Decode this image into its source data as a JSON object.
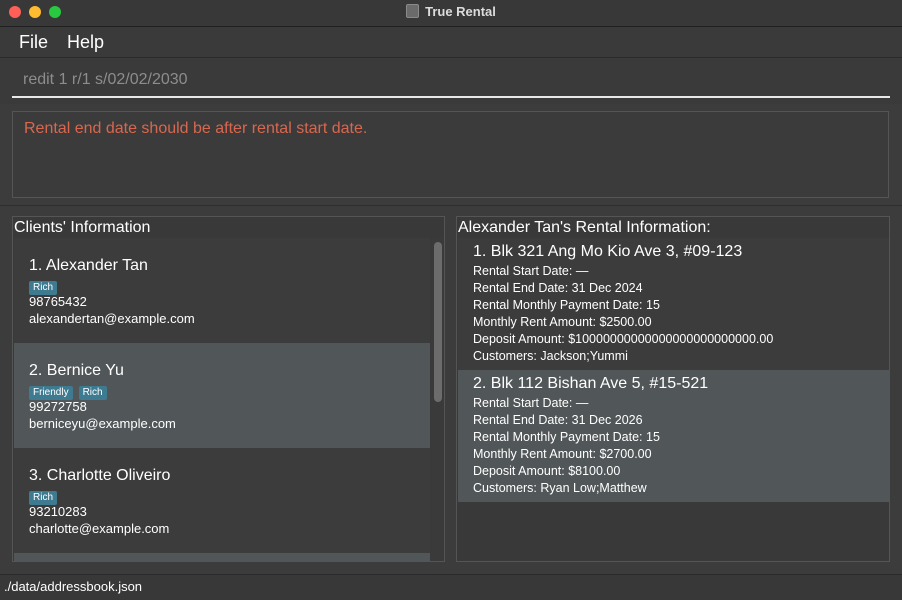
{
  "window": {
    "title": "True Rental"
  },
  "menu": {
    "file": "File",
    "help": "Help"
  },
  "command": {
    "value": "redit 1 r/1 s/02/02/2030"
  },
  "result": {
    "message": "Rental end date should be after rental start date."
  },
  "clients_panel": {
    "title": "Clients' Information",
    "clients": [
      {
        "name": "1. Alexander Tan",
        "tags": [
          "Rich"
        ],
        "phone": "98765432",
        "email": "alexandertan@example.com"
      },
      {
        "name": "2. Bernice Yu",
        "tags": [
          "Friendly",
          "Rich"
        ],
        "phone": "99272758",
        "email": "berniceyu@example.com"
      },
      {
        "name": "3. Charlotte Oliveiro",
        "tags": [
          "Rich"
        ],
        "phone": "93210283",
        "email": "charlotte@example.com"
      }
    ]
  },
  "rental_panel": {
    "title": "Alexander Tan's Rental Information:",
    "rentals": [
      {
        "address": "1. Blk 321 Ang Mo Kio Ave 3, #09-123",
        "start": "Rental Start Date: —",
        "end": "Rental End Date: 31 Dec 2024",
        "payment_date": "Rental Monthly Payment Date: 15",
        "rent": "Monthly Rent Amount: $2500.00",
        "deposit": "Deposit Amount: $10000000000000000000000000.00",
        "customers": "Customers: Jackson;Yummi"
      },
      {
        "address": "2. Blk 112 Bishan Ave 5, #15-521",
        "start": "Rental Start Date: —",
        "end": "Rental End Date: 31 Dec 2026",
        "payment_date": "Rental Monthly Payment Date: 15",
        "rent": "Monthly Rent Amount: $2700.00",
        "deposit": "Deposit Amount: $8100.00",
        "customers": "Customers: Ryan Low;Matthew"
      }
    ]
  },
  "status": {
    "path": "./data/addressbook.json"
  },
  "colors": {
    "error_text": "#d9674f",
    "tag_bg": "#3e7b91",
    "selected_row": "#515658"
  },
  "icons": {
    "app": "app-icon"
  }
}
